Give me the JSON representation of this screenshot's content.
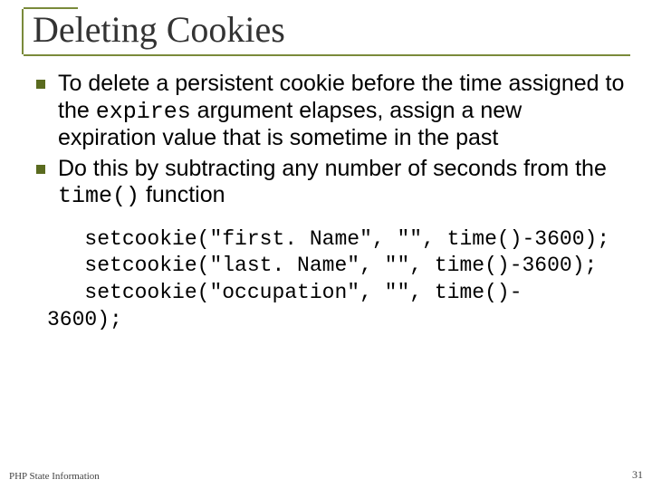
{
  "title": "Deleting Cookies",
  "bullets": [
    {
      "pre": "To delete a persistent cookie before the time assigned to the ",
      "code": "expires",
      "post": " argument elapses, assign a new expiration value that is sometime in the past"
    },
    {
      "pre": "Do this by subtracting any number of seconds from the ",
      "code": "time()",
      "post": " function"
    }
  ],
  "code_lines": [
    "   setcookie(\"first. Name\", \"\", time()-3600);",
    "   setcookie(\"last. Name\", \"\", time()-3600);",
    "   setcookie(\"occupation\", \"\", time()-",
    "3600);"
  ],
  "footer_left": "PHP State Information",
  "footer_right": "31"
}
